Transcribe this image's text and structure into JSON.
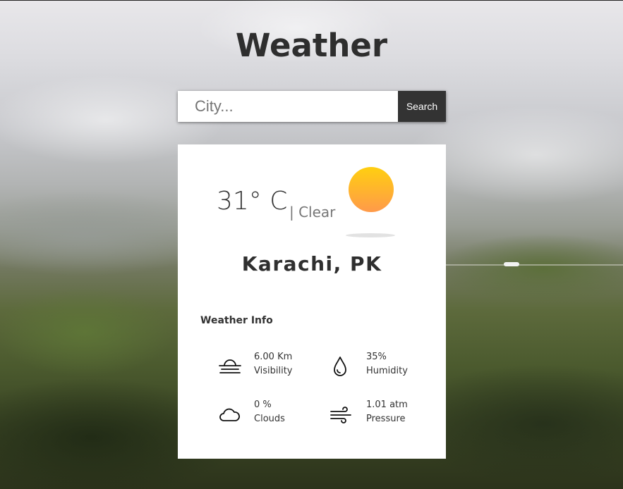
{
  "page": {
    "title": "Weather"
  },
  "search": {
    "placeholder": "City...",
    "value": "",
    "button_label": "Search"
  },
  "weather": {
    "temperature": "31° C",
    "condition": "| Clear",
    "condition_icon": "sun-icon",
    "location": "Karachi, PK"
  },
  "info": {
    "heading": "Weather Info",
    "items": [
      {
        "value": "6.00 Km",
        "label": "Visibility",
        "icon": "visibility-icon"
      },
      {
        "value": "35%",
        "label": "Humidity",
        "icon": "humidity-icon"
      },
      {
        "value": "0 %",
        "label": "Clouds",
        "icon": "cloud-icon"
      },
      {
        "value": "1.01 atm",
        "label": "Pressure",
        "icon": "wind-icon"
      }
    ]
  },
  "colors": {
    "sun_top": "#ffcf10",
    "sun_bottom": "#ff9a4a",
    "button_bg": "#333333"
  }
}
